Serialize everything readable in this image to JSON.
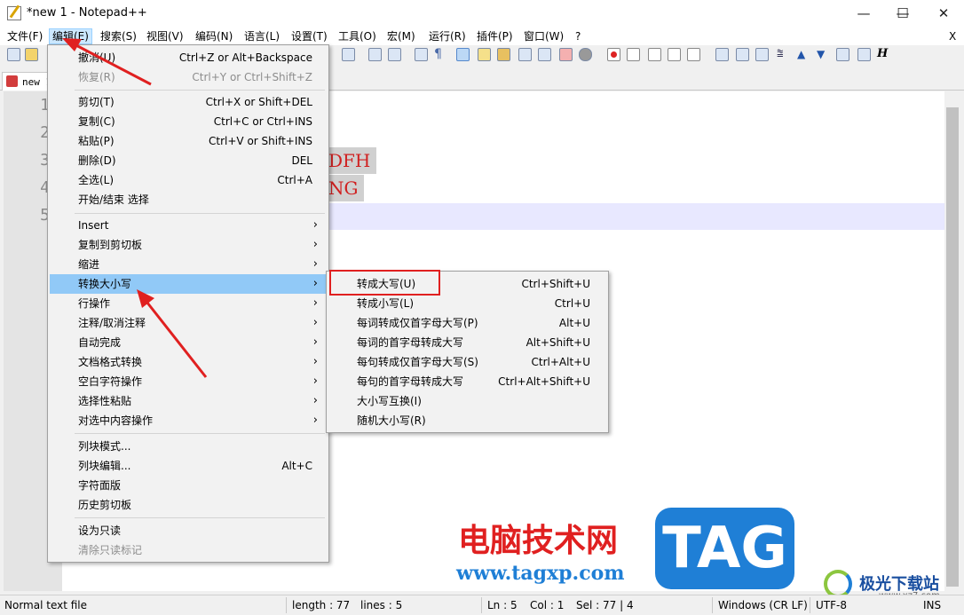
{
  "window": {
    "title": "*new 1 - Notepad++",
    "minimize": "—",
    "maximize": "☐",
    "close": "✕"
  },
  "menubar": {
    "items": [
      "文件(F)",
      "编辑(E)",
      "搜索(S)",
      "视图(V)",
      "编码(N)",
      "语言(L)",
      "设置(T)",
      "工具(O)",
      "宏(M)",
      "运行(R)",
      "插件(P)",
      "窗口(W)",
      "?"
    ],
    "close": "X"
  },
  "tab": {
    "label": "new 1"
  },
  "editor": {
    "line_numbers": [
      "1",
      "2",
      "3",
      "4",
      "5"
    ],
    "visible_text": [
      {
        "line": "3",
        "text": "DFH"
      },
      {
        "line": "4",
        "text": "NG"
      }
    ]
  },
  "edit_menu": {
    "items": [
      {
        "label": "撤消(U)",
        "shortcut": "Ctrl+Z or Alt+Backspace"
      },
      {
        "label": "恢复(R)",
        "shortcut": "Ctrl+Y or Ctrl+Shift+Z",
        "disabled": true
      },
      {
        "label": "剪切(T)",
        "shortcut": "Ctrl+X or Shift+DEL"
      },
      {
        "label": "复制(C)",
        "shortcut": "Ctrl+C or Ctrl+INS"
      },
      {
        "label": "粘贴(P)",
        "shortcut": "Ctrl+V or Shift+INS"
      },
      {
        "label": "删除(D)",
        "shortcut": "DEL"
      },
      {
        "label": "全选(L)",
        "shortcut": "Ctrl+A"
      },
      {
        "label": "开始/结束 选择",
        "shortcut": ""
      },
      {
        "label": "Insert",
        "submenu": true
      },
      {
        "label": "复制到剪切板",
        "submenu": true
      },
      {
        "label": "缩进",
        "submenu": true
      },
      {
        "label": "转换大小写",
        "submenu": true,
        "highlighted": true
      },
      {
        "label": "行操作",
        "submenu": true
      },
      {
        "label": "注释/取消注释",
        "submenu": true
      },
      {
        "label": "自动完成",
        "submenu": true
      },
      {
        "label": "文档格式转换",
        "submenu": true
      },
      {
        "label": "空白字符操作",
        "submenu": true
      },
      {
        "label": "选择性粘贴",
        "submenu": true
      },
      {
        "label": "对选中内容操作",
        "submenu": true
      },
      {
        "label": "列块模式...",
        "shortcut": ""
      },
      {
        "label": "列块编辑...",
        "shortcut": "Alt+C"
      },
      {
        "label": "字符面版",
        "shortcut": ""
      },
      {
        "label": "历史剪切板",
        "shortcut": ""
      },
      {
        "label": "设为只读",
        "shortcut": ""
      },
      {
        "label": "清除只读标记",
        "shortcut": "",
        "disabled": true
      }
    ],
    "submenu_arrow": "›"
  },
  "case_submenu": {
    "items": [
      {
        "label": "转成大写(U)",
        "shortcut": "Ctrl+Shift+U"
      },
      {
        "label": "转成小写(L)",
        "shortcut": "Ctrl+U"
      },
      {
        "label": "每词转成仅首字母大写(P)",
        "shortcut": "Alt+U"
      },
      {
        "label": "每词的首字母转成大写",
        "shortcut": "Alt+Shift+U"
      },
      {
        "label": "每句转成仅首字母大写(S)",
        "shortcut": "Ctrl+Alt+U"
      },
      {
        "label": "每句的首字母转成大写",
        "shortcut": "Ctrl+Alt+Shift+U"
      },
      {
        "label": "大小写互换(I)",
        "shortcut": ""
      },
      {
        "label": "随机大小写(R)",
        "shortcut": ""
      }
    ]
  },
  "statusbar": {
    "type": "Normal text file",
    "length": "length : 77",
    "lines": "lines : 5",
    "ln": "Ln : 5",
    "col": "Col : 1",
    "sel": "Sel : 77 | 4",
    "eol": "Windows (CR LF)",
    "encoding": "UTF-8",
    "mode": "INS"
  },
  "watermark": {
    "site_cn": "电脑技术网",
    "site_url": "www.tagxp.com",
    "logo": "TAG",
    "brand2": "极光下载站",
    "brand2_url": "www.xz7.com"
  },
  "colors": {
    "highlight": "#91c9f7",
    "red_box": "#e02020",
    "code_text": "#d02020",
    "tag_blue": "#1f7fd6"
  }
}
